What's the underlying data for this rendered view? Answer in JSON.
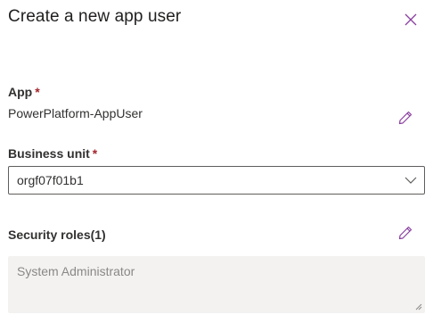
{
  "panel": {
    "title": "Create a new app user",
    "close_icon": "close-icon"
  },
  "app": {
    "label": "App",
    "required_mark": "*",
    "value": "PowerPlatform-AppUser",
    "edit_icon": "pencil-icon"
  },
  "business_unit": {
    "label": "Business unit",
    "required_mark": "*",
    "selected": "orgf07f01b1",
    "chevron_icon": "chevron-down-icon"
  },
  "security_roles": {
    "label": "Security roles(1)",
    "value": "System Administrator",
    "edit_icon": "pencil-icon"
  },
  "colors": {
    "accent": "#8a3fa0",
    "required": "#a4262c",
    "field_bg": "#f3f2f1",
    "text": "#323130",
    "placeholder": "#8a8886"
  }
}
